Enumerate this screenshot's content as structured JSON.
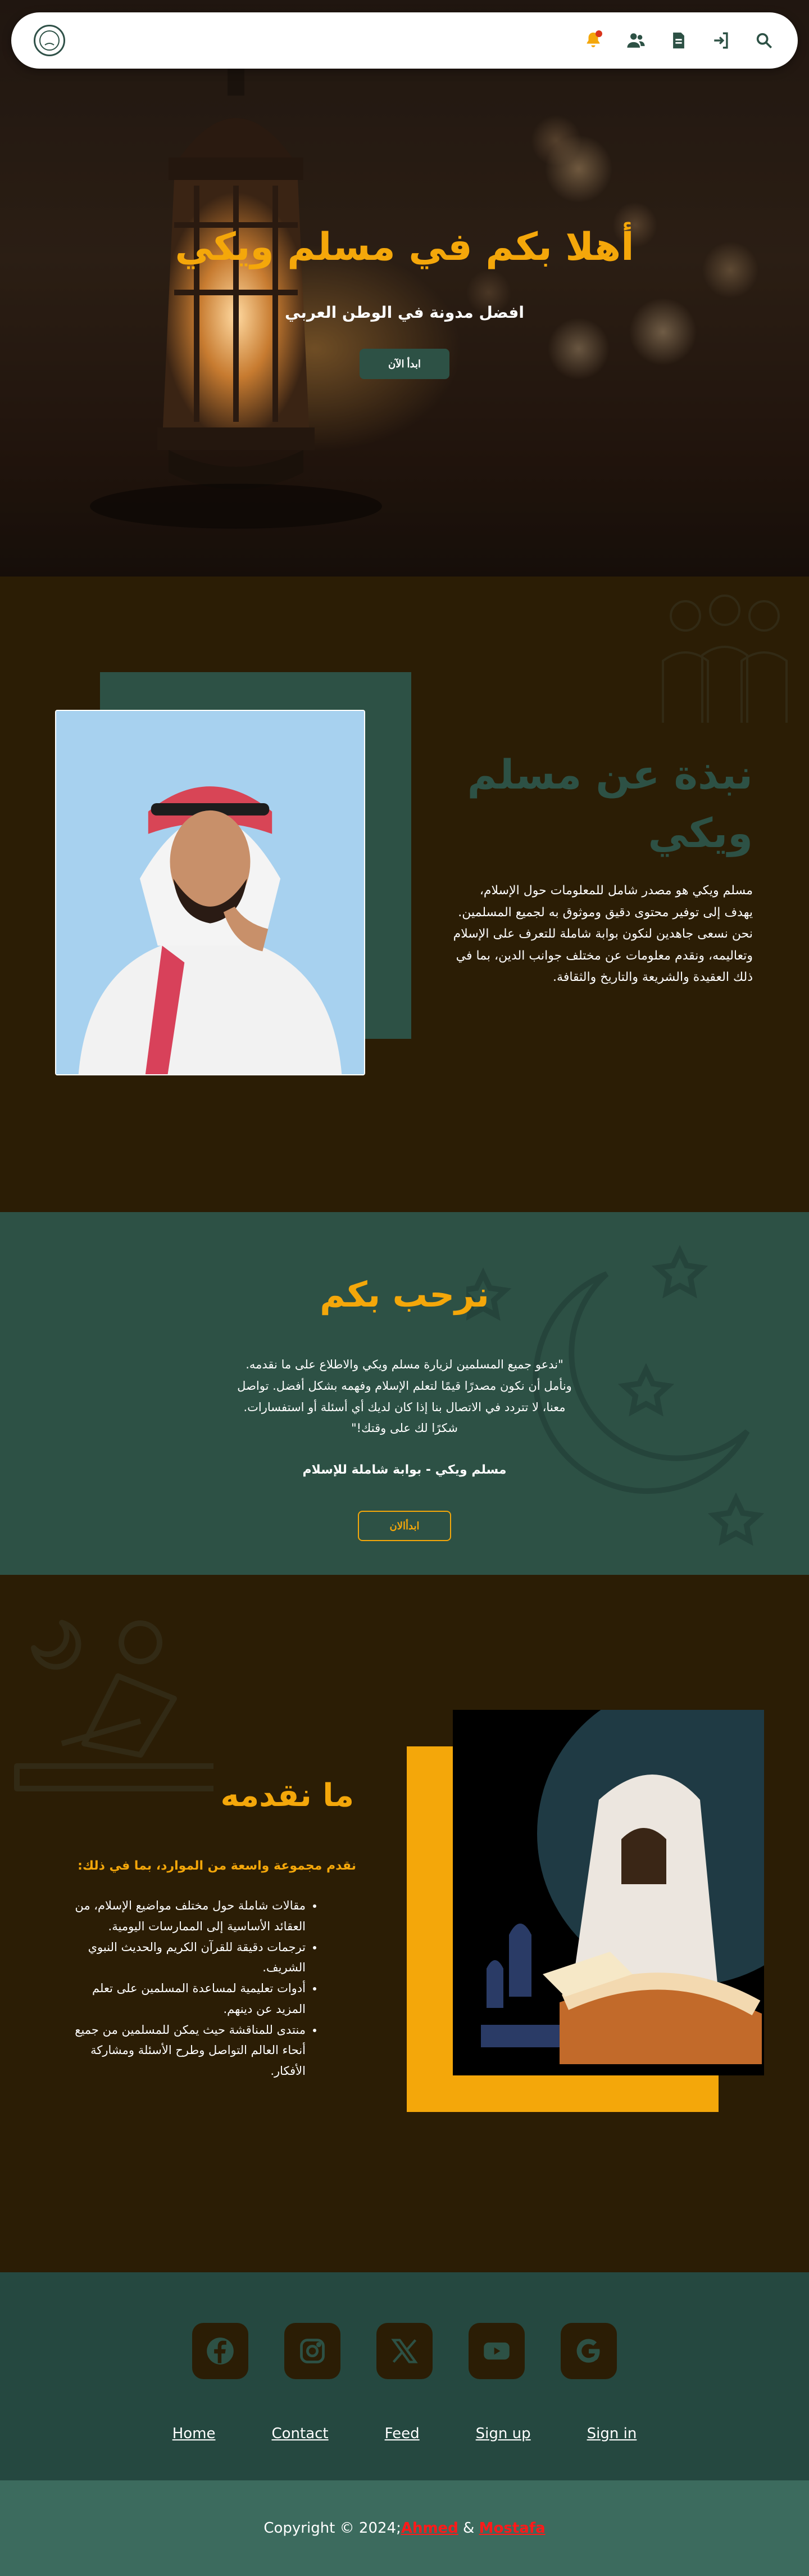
{
  "nav": {
    "logo_alt": "Muslim Wiki logo",
    "icons": [
      "bell-icon",
      "users-icon",
      "document-icon",
      "login-icon",
      "search-icon"
    ],
    "colors": {
      "icon": "#2d5145",
      "bell": "#f4a70a",
      "notification": "#d9341c"
    }
  },
  "hero": {
    "title": "أهلا بكم في مسلم ويكي",
    "subtitle": "افضل مدونة في الوطن العربي",
    "button": "ابدأ الآن"
  },
  "about": {
    "title": "نبذة عن مسلم ويكي",
    "text": "مسلم ويكي هو مصدر شامل للمعلومات حول الإسلام، يهدف إلى توفير محتوى دقيق وموثوق به لجميع المسلمين. نحن نسعى جاهدين لنكون بوابة شاملة للتعرف على الإسلام وتعاليمه، ونقدم معلومات عن مختلف جوانب الدين، بما في ذلك العقيدة والشريعة والتاريخ والثقافة."
  },
  "welcome": {
    "title": "نرحب بكم",
    "text": "\"ندعو جميع المسلمين لزيارة مسلم ويكي والاطلاع على ما نقدمه. ونأمل أن نكون مصدرًا قيمًا لتعلم الإسلام وفهمه بشكل أفضل. تواصل معنا، لا تتردد في الاتصال بنا إذا كان لديك أي أسئلة أو استفسارات. شكرًا لك على وقتك!\"",
    "tagline": "مسلم ويكي - بوابة شاملة للإسلام",
    "button": "ابدأالان"
  },
  "services": {
    "title": "ما نقدمه",
    "intro": "نقدم مجموعة واسعة من الموارد، بما في ذلك:",
    "items": [
      "مقالات شاملة حول مختلف مواضيع الإسلام، من العقائد الأساسية إلى الممارسات اليومية.",
      "ترجمات دقيقة للقرآن الكريم والحديث النبوي الشريف.",
      "أدوات تعليمية لمساعدة المسلمين على تعلم المزيد عن دينهم.",
      "منتدى للمناقشة حيث يمكن للمسلمين من جميع أنحاء العالم التواصل وطرح الأسئلة ومشاركة الأفكار."
    ]
  },
  "footer": {
    "socials": [
      "facebook-icon",
      "instagram-icon",
      "x-icon",
      "youtube-icon",
      "google-icon"
    ],
    "links": [
      "Home",
      "Contact",
      "Feed",
      "Sign up",
      "Sign in"
    ],
    "copyright_prefix": "Copyright © 2024; ",
    "author1": "Ahmed",
    "separator": " & ",
    "author2": "Mostafa"
  },
  "colors": {
    "gold": "#f4a70a",
    "green": "#2d5145",
    "dark_brown": "#2b1d05",
    "author_link": "#ff1a1a"
  }
}
